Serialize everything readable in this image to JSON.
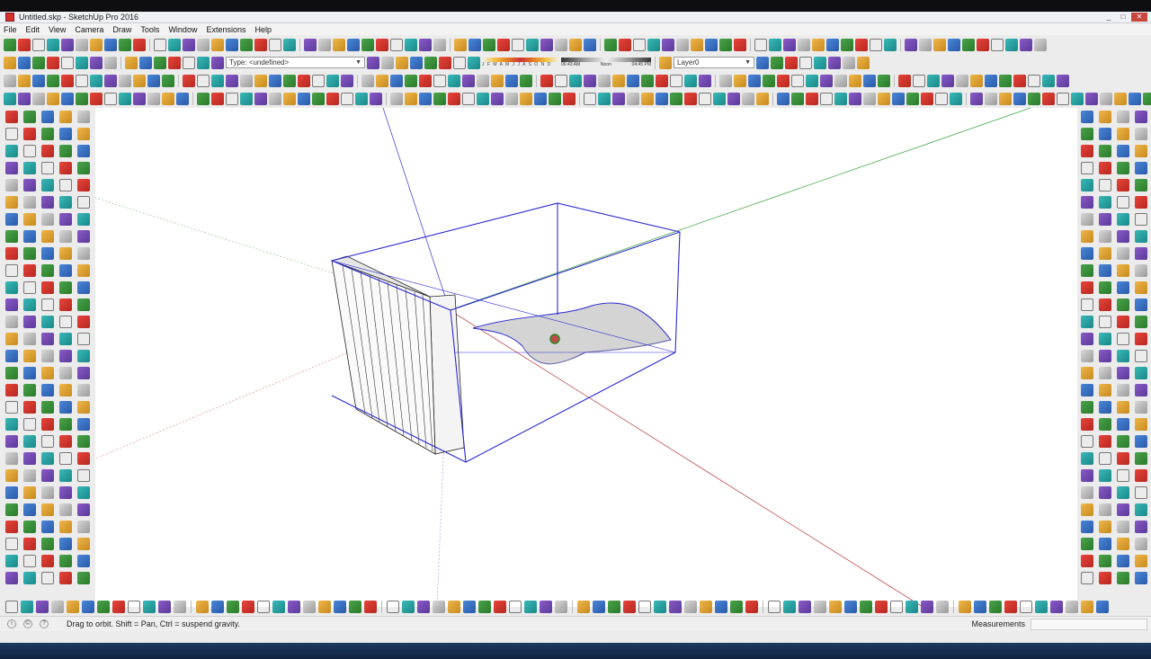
{
  "window": {
    "title": "Untitled.skp - SketchUp Pro 2016",
    "controls": [
      "_",
      "□",
      "✕"
    ]
  },
  "menu": [
    "File",
    "Edit",
    "View",
    "Camera",
    "Draw",
    "Tools",
    "Window",
    "Extensions",
    "Help"
  ],
  "toolbar": {
    "row1_count": 70,
    "row2_count": 44,
    "row3_count": 72,
    "row4_count": 78,
    "type_dropdown": "Type: <undefined>",
    "shadow_months": "J F M A M J J A S O N D",
    "time_start": "06:43 AM",
    "time_mid": "Noon",
    "time_end": "04:45 PM",
    "layer_dropdown": "Layer0"
  },
  "bottom_toolbar_count": 70,
  "status": {
    "message": "Drag to orbit. Shift = Pan, Ctrl = suspend gravity.",
    "measurements_label": "Measurements",
    "measurements_value": ""
  },
  "colors": {
    "selection_blue": "#2a2ad4",
    "axis_red": "#c24a4a",
    "axis_green": "#4aa84a",
    "axis_blue": "#4a4ad4",
    "background": "#ffffff"
  }
}
